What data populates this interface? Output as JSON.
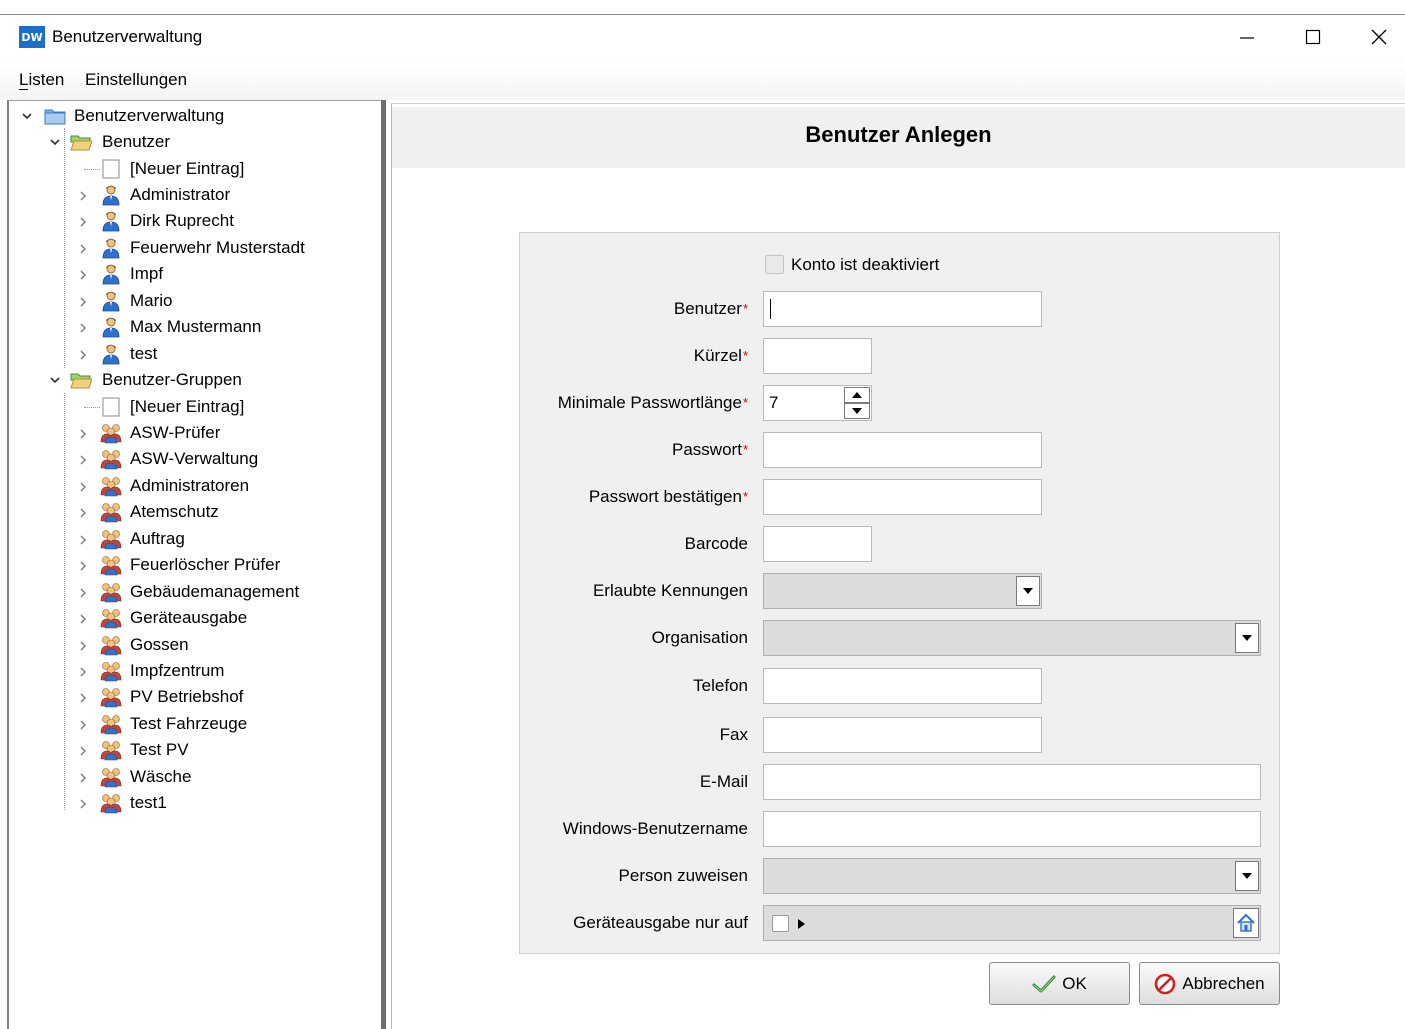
{
  "window": {
    "logo_text": "DW",
    "title": "Benutzerverwaltung",
    "minimize_glyph": "—",
    "maximize_glyph": "☐",
    "close_glyph": "✕"
  },
  "menu": {
    "items": [
      "Listen",
      "Einstellungen"
    ]
  },
  "tree": {
    "root": "Benutzerverwaltung",
    "users_group": "Benutzer",
    "users": [
      "[Neuer Eintrag]",
      "Administrator",
      "Dirk Ruprecht",
      "Feuerwehr Musterstadt",
      "Impf",
      "Mario",
      "Max Mustermann",
      "test"
    ],
    "groups_group": "Benutzer-Gruppen",
    "groups": [
      "[Neuer Eintrag]",
      "ASW-Prüfer",
      "ASW-Verwaltung",
      "Administratoren",
      "Atemschutz",
      "Auftrag",
      "Feuerlöscher Prüfer",
      "Gebäudemanagement",
      "Geräteausgabe",
      "Gossen",
      "Impfzentrum",
      "PV Betriebshof",
      "Test Fahrzeuge",
      "Test PV",
      "Wäsche",
      "test1"
    ]
  },
  "form": {
    "title": "Benutzer Anlegen",
    "deactivated_label": "Konto ist deaktiviert",
    "deactivated_checked": false,
    "required_marker": "*",
    "fields": {
      "benutzer": {
        "label": "Benutzer",
        "value": ""
      },
      "kuerzel": {
        "label": "Kürzel",
        "value": ""
      },
      "min_pw_len": {
        "label": "Minimale Passwortlänge",
        "value": "7"
      },
      "passwort": {
        "label": "Passwort",
        "value": ""
      },
      "passwort_bestaetigen": {
        "label": "Passwort bestätigen",
        "value": ""
      },
      "barcode": {
        "label": "Barcode",
        "value": ""
      },
      "erlaubte_kennungen": {
        "label": "Erlaubte Kennungen",
        "value": ""
      },
      "organisation": {
        "label": "Organisation",
        "value": ""
      },
      "telefon": {
        "label": "Telefon",
        "value": ""
      },
      "fax": {
        "label": "Fax",
        "value": ""
      },
      "email": {
        "label": "E-Mail",
        "value": ""
      },
      "windows_benutzername": {
        "label": "Windows-Benutzername",
        "value": ""
      },
      "person_zuweisen": {
        "label": "Person zuweisen",
        "value": ""
      },
      "geraeteausgabe": {
        "label": "Geräteausgabe nur auf",
        "value": ""
      }
    },
    "ok_label": "OK",
    "cancel_label": "Abbrechen"
  },
  "icons": {
    "app": "dw-logo-icon",
    "folder": "folder-icon",
    "open_folder": "folder-open-icon",
    "user": "user-icon",
    "group": "user-group-icon",
    "new_entry": "blank-page-icon",
    "ok": "check-icon",
    "cancel": "cancel-icon",
    "home": "home-icon"
  },
  "colors": {
    "accent": "#1b6fc8",
    "required": "#d00000",
    "header_bg": "#f0f0f0",
    "splitter": "#6e6e6e"
  }
}
